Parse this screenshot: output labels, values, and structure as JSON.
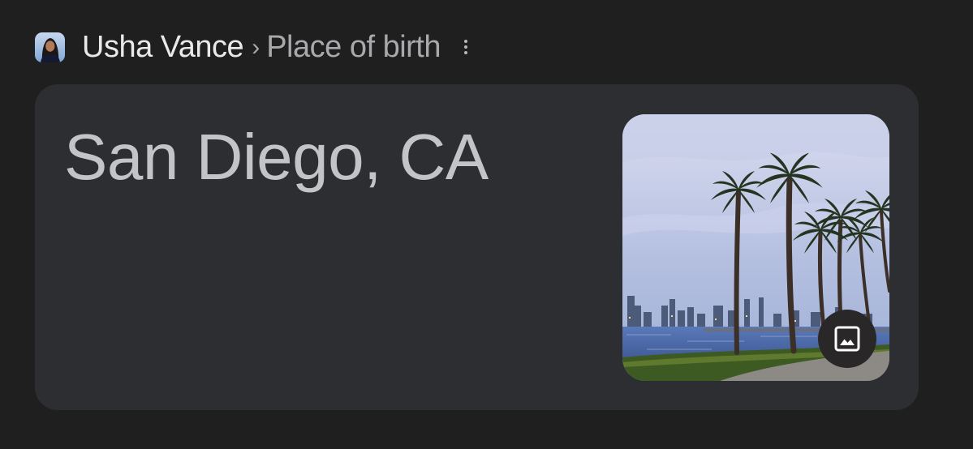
{
  "breadcrumb": {
    "entity_name": "Usha Vance",
    "separator": "›",
    "attribute": "Place of birth"
  },
  "answer": {
    "text": "San Diego, CA"
  },
  "icons": {
    "avatar": "person-avatar",
    "more": "more-vert-icon",
    "image_badge": "image-icon"
  },
  "colors": {
    "page_background": "#1f1f20",
    "card_background": "#2d2e31",
    "primary_text": "#e9e9ea",
    "secondary_text": "#a8a9ab",
    "answer_text": "#c3c4c6"
  }
}
